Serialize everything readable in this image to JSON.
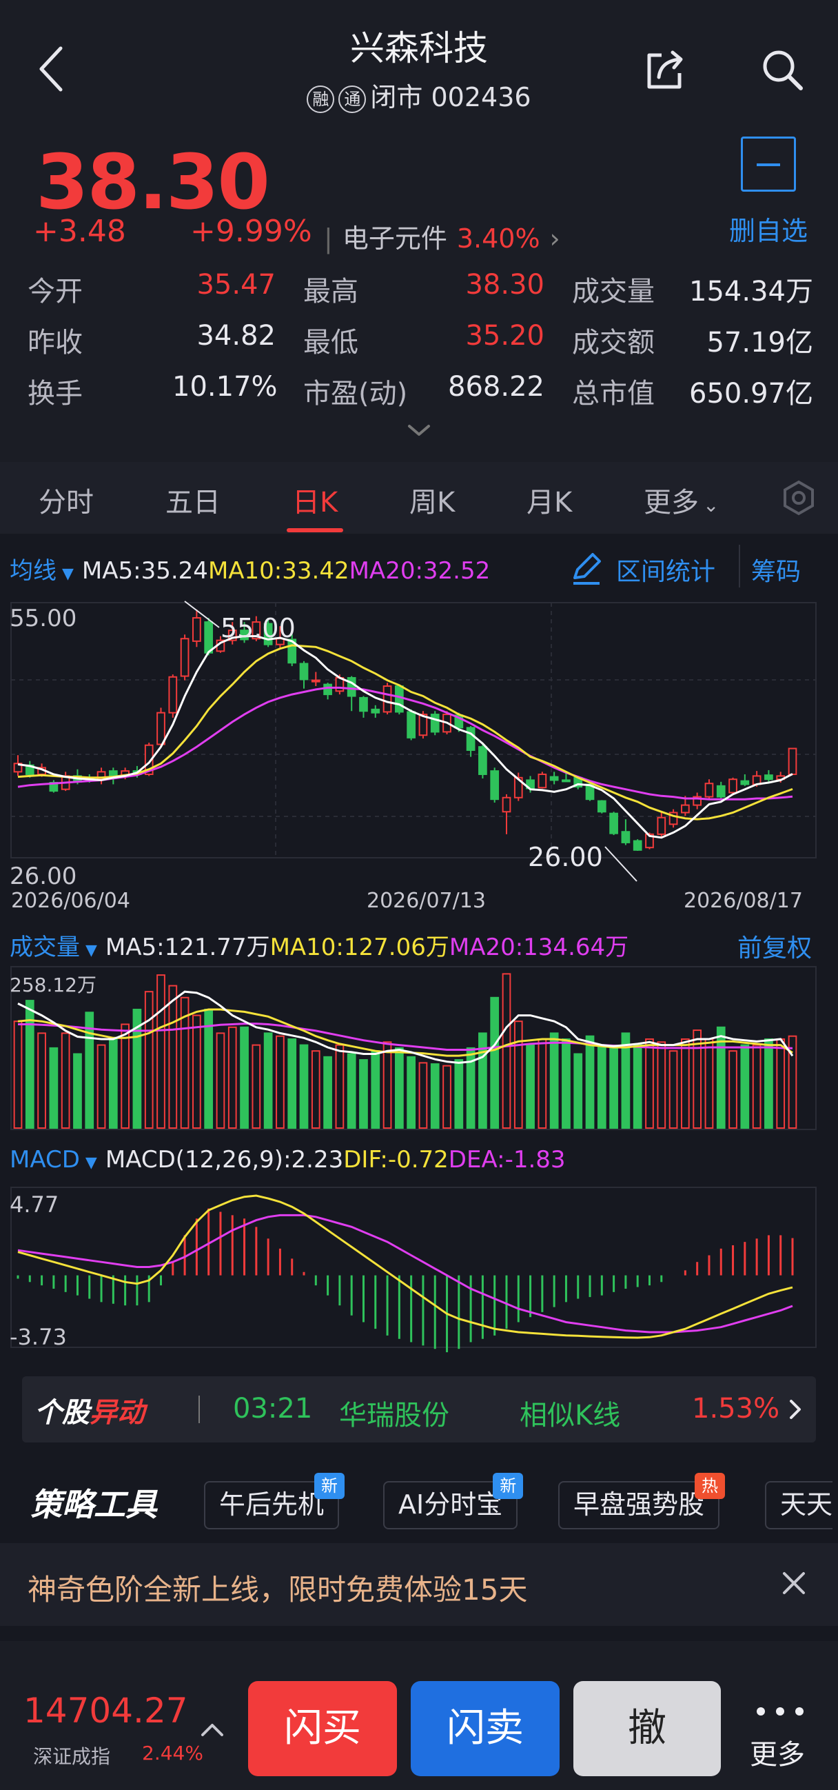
{
  "header": {
    "title": "兴森科技",
    "tag1": "融",
    "tag2": "通",
    "status_code": "闭市 002436"
  },
  "quote": {
    "price": "38.30",
    "change": "+3.48",
    "change_pct": "+9.99%",
    "sector_name": "电子元件",
    "sector_pct": "3.40%",
    "fav_label": "删自选",
    "stats": {
      "open_label": "今开",
      "open": "35.47",
      "high_label": "最高",
      "high": "38.30",
      "vol_label": "成交量",
      "vol": "154.34万",
      "prev_label": "昨收",
      "prev": "34.82",
      "low_label": "最低",
      "low": "35.20",
      "amt_label": "成交额",
      "amt": "57.19亿",
      "turn_label": "换手",
      "turn": "10.17%",
      "pe_label": "市盈(动)",
      "pe": "868.22",
      "mcap_label": "总市值",
      "mcap": "650.97亿"
    }
  },
  "tabs": [
    "分时",
    "五日",
    "日K",
    "周K",
    "月K",
    "更多"
  ],
  "ma_legend": {
    "label": "均线",
    "ma5": "MA5:35.24",
    "ma10": "MA10:33.42",
    "ma20": "MA20:32.52",
    "range_stats": "区间统计",
    "chips": "筹码"
  },
  "vol_legend": {
    "label": "成交量",
    "ma5": "MA5:121.77万",
    "ma10": "MA10:127.06万",
    "ma20": "MA20:134.64万",
    "adjust": "前复权"
  },
  "macd_legend": {
    "label": "MACD",
    "macd": "MACD(12,26,9):2.23",
    "dif": "DIF:-0.72",
    "dea": "DEA:-1.83"
  },
  "chart_data": [
    {
      "type": "candlestick",
      "title": "",
      "y_range": [
        26.0,
        55.0
      ],
      "max_label": "55.00",
      "min_label": "26.00",
      "high_mark": "55.00",
      "low_mark": "26.00",
      "x_labels": [
        "2026/06/04",
        "2026/07/13",
        "2026/08/17"
      ],
      "candles": [
        {
          "o": 35.5,
          "c": 36.5,
          "h": 37.5,
          "l": 35.0
        },
        {
          "o": 36.3,
          "c": 35.2,
          "h": 36.8,
          "l": 34.8
        },
        {
          "o": 35.2,
          "c": 36.0,
          "h": 36.5,
          "l": 34.9
        },
        {
          "o": 34.2,
          "c": 33.2,
          "h": 34.5,
          "l": 33.0
        },
        {
          "o": 33.4,
          "c": 35.0,
          "h": 35.5,
          "l": 33.2
        },
        {
          "o": 35.0,
          "c": 34.3,
          "h": 35.8,
          "l": 34.0
        },
        {
          "o": 34.8,
          "c": 34.6,
          "h": 35.2,
          "l": 34.2
        },
        {
          "o": 34.6,
          "c": 35.5,
          "h": 36.0,
          "l": 34.0
        },
        {
          "o": 35.6,
          "c": 34.9,
          "h": 36.0,
          "l": 34.0
        },
        {
          "o": 35.0,
          "c": 35.6,
          "h": 36.0,
          "l": 34.6
        },
        {
          "o": 35.6,
          "c": 35.2,
          "h": 36.2,
          "l": 34.8
        },
        {
          "o": 35.2,
          "c": 38.7,
          "h": 39.0,
          "l": 35.0
        },
        {
          "o": 38.8,
          "c": 42.6,
          "h": 43.2,
          "l": 38.5
        },
        {
          "o": 42.6,
          "c": 46.9,
          "h": 47.2,
          "l": 42.0
        },
        {
          "o": 47.0,
          "c": 51.5,
          "h": 52.0,
          "l": 46.5
        },
        {
          "o": 51.2,
          "c": 54.0,
          "h": 55.0,
          "l": 50.5
        },
        {
          "o": 53.5,
          "c": 49.8,
          "h": 54.0,
          "l": 49.5
        },
        {
          "o": 50.0,
          "c": 51.3,
          "h": 51.8,
          "l": 49.8
        },
        {
          "o": 51.3,
          "c": 52.5,
          "h": 53.5,
          "l": 50.8
        },
        {
          "o": 52.5,
          "c": 51.4,
          "h": 53.5,
          "l": 51.0
        },
        {
          "o": 51.5,
          "c": 53.5,
          "h": 54.2,
          "l": 51.2
        },
        {
          "o": 53.3,
          "c": 50.8,
          "h": 54.0,
          "l": 50.5
        },
        {
          "o": 50.8,
          "c": 51.5,
          "h": 53.0,
          "l": 50.2
        },
        {
          "o": 51.4,
          "c": 48.6,
          "h": 52.0,
          "l": 48.2
        },
        {
          "o": 48.5,
          "c": 46.6,
          "h": 48.8,
          "l": 45.5
        },
        {
          "o": 46.5,
          "c": 46.5,
          "h": 47.5,
          "l": 45.8
        },
        {
          "o": 46.0,
          "c": 44.8,
          "h": 46.2,
          "l": 44.2
        },
        {
          "o": 45.2,
          "c": 46.8,
          "h": 47.2,
          "l": 44.8
        },
        {
          "o": 46.8,
          "c": 44.6,
          "h": 47.0,
          "l": 42.8
        },
        {
          "o": 44.4,
          "c": 42.8,
          "h": 44.6,
          "l": 42.0
        },
        {
          "o": 43.0,
          "c": 42.6,
          "h": 43.5,
          "l": 42.0
        },
        {
          "o": 42.7,
          "c": 45.8,
          "h": 46.2,
          "l": 42.4
        },
        {
          "o": 45.8,
          "c": 42.7,
          "h": 46.0,
          "l": 42.4
        },
        {
          "o": 42.7,
          "c": 39.6,
          "h": 43.0,
          "l": 39.3
        },
        {
          "o": 39.9,
          "c": 42.4,
          "h": 42.8,
          "l": 39.5
        },
        {
          "o": 42.4,
          "c": 40.3,
          "h": 42.8,
          "l": 39.9
        },
        {
          "o": 40.3,
          "c": 42.4,
          "h": 42.8,
          "l": 40.0
        },
        {
          "o": 42.3,
          "c": 40.8,
          "h": 42.6,
          "l": 40.3
        },
        {
          "o": 40.8,
          "c": 38.1,
          "h": 41.0,
          "l": 37.3
        },
        {
          "o": 38.5,
          "c": 35.2,
          "h": 38.8,
          "l": 34.7
        },
        {
          "o": 35.6,
          "c": 32.2,
          "h": 36.0,
          "l": 31.8
        },
        {
          "o": 30.7,
          "c": 32.4,
          "h": 32.8,
          "l": 28.0
        },
        {
          "o": 32.4,
          "c": 34.8,
          "h": 35.4,
          "l": 32.0
        },
        {
          "o": 34.5,
          "c": 33.5,
          "h": 35.0,
          "l": 33.0
        },
        {
          "o": 33.6,
          "c": 35.2,
          "h": 35.5,
          "l": 33.5
        },
        {
          "o": 34.9,
          "c": 34.5,
          "h": 35.5,
          "l": 34.0
        },
        {
          "o": 34.5,
          "c": 34.4,
          "h": 35.5,
          "l": 34.3
        },
        {
          "o": 34.8,
          "c": 33.7,
          "h": 35.0,
          "l": 33.4
        },
        {
          "o": 34.0,
          "c": 32.2,
          "h": 34.1,
          "l": 32.0
        },
        {
          "o": 32.0,
          "c": 30.7,
          "h": 32.1,
          "l": 30.5
        },
        {
          "o": 30.5,
          "c": 28.1,
          "h": 30.7,
          "l": 27.9
        },
        {
          "o": 28.3,
          "c": 27.0,
          "h": 29.8,
          "l": 26.7
        },
        {
          "o": 27.2,
          "c": 26.1,
          "h": 27.4,
          "l": 26.0
        },
        {
          "o": 26.4,
          "c": 28.0,
          "h": 28.2,
          "l": 26.2
        },
        {
          "o": 28.0,
          "c": 30.0,
          "h": 30.8,
          "l": 27.6
        },
        {
          "o": 29.2,
          "c": 30.6,
          "h": 31.0,
          "l": 28.8
        },
        {
          "o": 30.6,
          "c": 31.5,
          "h": 32.6,
          "l": 30.2
        },
        {
          "o": 31.5,
          "c": 32.5,
          "h": 33.0,
          "l": 31.0
        },
        {
          "o": 32.5,
          "c": 34.1,
          "h": 34.6,
          "l": 32.3
        },
        {
          "o": 33.8,
          "c": 32.5,
          "h": 34.3,
          "l": 32.2
        },
        {
          "o": 33.0,
          "c": 34.6,
          "h": 34.8,
          "l": 32.7
        },
        {
          "o": 34.4,
          "c": 34.0,
          "h": 35.2,
          "l": 33.8
        },
        {
          "o": 34.0,
          "c": 35.0,
          "h": 35.6,
          "l": 33.7
        },
        {
          "o": 35.1,
          "c": 34.6,
          "h": 35.7,
          "l": 34.3
        },
        {
          "o": 34.6,
          "c": 35.0,
          "h": 35.5,
          "l": 34.2
        },
        {
          "o": 35.2,
          "c": 38.3,
          "h": 38.3,
          "l": 35.2
        }
      ],
      "ma5": [
        36.4,
        36.2,
        35.8,
        35.2,
        34.9,
        34.7,
        34.6,
        34.5,
        34.8,
        35.0,
        35.4,
        36.6,
        38.5,
        41.2,
        44.6,
        47.5,
        49.9,
        51.0,
        51.6,
        51.8,
        51.8,
        51.4,
        51.6,
        51.2,
        50.1,
        49.2,
        47.8,
        46.8,
        46.2,
        45.2,
        44.4,
        43.9,
        43.6,
        42.8,
        42.2,
        41.8,
        41.4,
        40.6,
        40.1,
        38.9,
        37.4,
        35.8,
        34.6,
        33.4,
        33.3,
        33.1,
        33.4,
        34.0,
        33.9,
        33.3,
        32.3,
        30.8,
        29.3,
        27.8,
        27.6,
        28.2,
        29.0,
        30.3,
        31.6,
        31.9,
        32.8,
        33.4,
        34.0,
        34.2,
        34.5,
        35.24
      ],
      "ma10": [
        34.9,
        35.0,
        35.1,
        35.0,
        34.9,
        34.9,
        34.8,
        34.8,
        34.9,
        35.1,
        35.3,
        35.8,
        36.5,
        37.7,
        39.3,
        41.0,
        43.0,
        44.6,
        46.0,
        47.5,
        48.8,
        49.7,
        50.3,
        50.7,
        50.6,
        50.5,
        50.0,
        49.4,
        48.8,
        48.0,
        47.3,
        46.5,
        45.9,
        45.1,
        44.6,
        43.8,
        43.2,
        42.4,
        41.9,
        41.2,
        40.3,
        39.3,
        38.4,
        37.3,
        36.8,
        36.2,
        35.5,
        34.8,
        34.2,
        33.6,
        33.0,
        32.4,
        31.9,
        31.2,
        30.7,
        30.2,
        29.9,
        29.8,
        29.9,
        30.2,
        30.6,
        31.2,
        31.8,
        32.4,
        32.9,
        33.42
      ],
      "ma20": [
        33.7,
        33.9,
        34.0,
        34.1,
        34.2,
        34.3,
        34.4,
        34.5,
        34.7,
        34.9,
        35.1,
        35.6,
        36.1,
        36.8,
        37.6,
        38.5,
        39.5,
        40.5,
        41.5,
        42.4,
        43.2,
        43.9,
        44.4,
        44.8,
        45.1,
        45.4,
        45.6,
        45.6,
        45.5,
        45.4,
        45.1,
        44.8,
        44.5,
        44.1,
        43.7,
        43.2,
        42.6,
        42.0,
        41.3,
        40.5,
        39.8,
        39.0,
        38.2,
        37.4,
        36.7,
        36.0,
        35.4,
        34.9,
        34.4,
        34.0,
        33.7,
        33.4,
        33.1,
        32.8,
        32.6,
        32.5,
        32.3,
        32.3,
        32.2,
        32.2,
        32.2,
        32.2,
        32.3,
        32.3,
        32.4,
        32.52
      ]
    },
    {
      "type": "bar",
      "title": "成交量",
      "max_label": "258.12万",
      "y_range": [
        0,
        258.12
      ],
      "values": [
        180,
        215,
        160,
        135,
        160,
        125,
        195,
        140,
        150,
        175,
        200,
        230,
        258,
        240,
        220,
        190,
        200,
        160,
        170,
        170,
        140,
        160,
        155,
        150,
        140,
        130,
        120,
        140,
        125,
        115,
        130,
        145,
        135,
        120,
        110,
        108,
        105,
        115,
        135,
        160,
        220,
        260,
        180,
        140,
        150,
        160,
        150,
        125,
        155,
        140,
        135,
        160,
        140,
        150,
        145,
        130,
        150,
        165,
        150,
        170,
        130,
        140,
        140,
        150,
        150,
        155
      ],
      "ma5": [
        210,
        200,
        190,
        178,
        164,
        154,
        152,
        150,
        150,
        158,
        170,
        182,
        198,
        215,
        230,
        228,
        220,
        206,
        190,
        180,
        170,
        166,
        160,
        156,
        152,
        145,
        136,
        130,
        128,
        125,
        125,
        130,
        132,
        128,
        122,
        116,
        112,
        110,
        112,
        120,
        140,
        170,
        190,
        190,
        185,
        180,
        170,
        150,
        145,
        140,
        138,
        140,
        142,
        145,
        140,
        140,
        145,
        150,
        150,
        155,
        150,
        148,
        146,
        148,
        150,
        121.77
      ],
      "ma10": [
        180,
        182,
        180,
        176,
        172,
        166,
        160,
        156,
        152,
        152,
        154,
        160,
        170,
        178,
        188,
        196,
        200,
        200,
        198,
        196,
        192,
        188,
        180,
        172,
        164,
        155,
        148,
        142,
        138,
        134,
        130,
        128,
        128,
        127,
        126,
        124,
        122,
        122,
        124,
        128,
        132,
        140,
        146,
        148,
        150,
        150,
        148,
        144,
        140,
        138,
        136,
        136,
        138,
        140,
        140,
        140,
        140,
        142,
        144,
        146,
        146,
        144,
        142,
        140,
        140,
        127.06
      ],
      "ma20": [
        175,
        175,
        174,
        173,
        172,
        170,
        168,
        166,
        165,
        164,
        164,
        164,
        165,
        166,
        168,
        170,
        172,
        174,
        175,
        176,
        176,
        175,
        173,
        170,
        167,
        164,
        160,
        156,
        152,
        148,
        145,
        142,
        140,
        138,
        136,
        134,
        132,
        132,
        132,
        134,
        136,
        138,
        140,
        142,
        143,
        144,
        144,
        143,
        142,
        140,
        139,
        138,
        137,
        136,
        135,
        135,
        135,
        135,
        136,
        136,
        136,
        136,
        136,
        136,
        135,
        134.64
      ]
    },
    {
      "type": "macd",
      "title": "MACD",
      "max_label": "4.77",
      "min_label": "-3.73",
      "y_range": [
        -3.73,
        4.77
      ],
      "dif": [
        1.4,
        1.2,
        1.0,
        0.8,
        0.6,
        0.4,
        0.2,
        0.0,
        -0.2,
        -0.4,
        -0.5,
        -0.3,
        0.3,
        1.2,
        2.3,
        3.2,
        3.9,
        4.2,
        4.5,
        4.7,
        4.77,
        4.6,
        4.4,
        4.1,
        3.7,
        3.2,
        2.7,
        2.2,
        1.7,
        1.2,
        0.7,
        0.2,
        -0.3,
        -0.8,
        -1.3,
        -1.8,
        -2.3,
        -2.6,
        -2.8,
        -3.0,
        -3.2,
        -3.3,
        -3.4,
        -3.45,
        -3.5,
        -3.55,
        -3.6,
        -3.62,
        -3.65,
        -3.68,
        -3.7,
        -3.72,
        -3.73,
        -3.7,
        -3.6,
        -3.4,
        -3.2,
        -2.9,
        -2.6,
        -2.3,
        -2.0,
        -1.7,
        -1.4,
        -1.1,
        -0.9,
        -0.72
      ],
      "dea": [
        1.5,
        1.4,
        1.3,
        1.2,
        1.1,
        1.0,
        0.9,
        0.8,
        0.7,
        0.6,
        0.5,
        0.5,
        0.6,
        0.8,
        1.1,
        1.5,
        1.9,
        2.3,
        2.7,
        3.0,
        3.3,
        3.5,
        3.6,
        3.6,
        3.6,
        3.5,
        3.3,
        3.1,
        2.9,
        2.6,
        2.3,
        2.0,
        1.6,
        1.2,
        0.8,
        0.4,
        0.0,
        -0.4,
        -0.8,
        -1.1,
        -1.4,
        -1.7,
        -2.0,
        -2.2,
        -2.4,
        -2.6,
        -2.8,
        -2.9,
        -3.0,
        -3.1,
        -3.2,
        -3.3,
        -3.35,
        -3.4,
        -3.4,
        -3.4,
        -3.35,
        -3.3,
        -3.2,
        -3.1,
        -2.9,
        -2.7,
        -2.5,
        -2.3,
        -2.1,
        -1.83
      ],
      "hist": [
        -0.2,
        -0.4,
        -0.6,
        -0.8,
        -1.0,
        -1.2,
        -1.4,
        -1.6,
        -1.7,
        -1.8,
        -1.8,
        -1.6,
        -0.6,
        0.8,
        2.4,
        3.4,
        4.0,
        3.8,
        3.6,
        3.4,
        2.9,
        2.2,
        1.6,
        1.0,
        0.2,
        -0.6,
        -1.2,
        -1.8,
        -2.4,
        -2.8,
        -3.2,
        -3.6,
        -3.8,
        -4.0,
        -4.2,
        -4.4,
        -4.6,
        -4.4,
        -4.0,
        -3.8,
        -3.6,
        -3.2,
        -2.8,
        -2.5,
        -2.2,
        -1.9,
        -1.6,
        -1.4,
        -1.3,
        -1.2,
        -1.0,
        -0.8,
        -0.7,
        -0.6,
        -0.4,
        0.0,
        0.3,
        0.8,
        1.2,
        1.6,
        1.8,
        2.0,
        2.2,
        2.4,
        2.4,
        2.23
      ]
    }
  ],
  "banner": {
    "logo_a": "个股",
    "logo_b": "异动",
    "time": "03:21",
    "stock": "华瑞股份",
    "kline": "相似K线",
    "pct": "1.53%"
  },
  "strategy": {
    "logo": "策略工具",
    "chips": [
      {
        "label": "午后先机",
        "badge": "新"
      },
      {
        "label": "AI分时宝",
        "badge": "新"
      },
      {
        "label": "早盘强势股",
        "badge": "热"
      },
      {
        "label": "天天",
        "badge": ""
      }
    ]
  },
  "promo": {
    "text": "神奇色阶全新上线，限时免费体验15天"
  },
  "bottom": {
    "index_value": "14704.27",
    "index_name": "深证成指",
    "index_pct": "2.44%",
    "buy": "闪买",
    "sell": "闪卖",
    "cancel": "撤",
    "more": "更多"
  },
  "colors": {
    "up": "#f23b3b",
    "down": "#2fc25b",
    "accent": "#2f8ff0",
    "ma5": "#ffffff",
    "ma10": "#f5e23a",
    "ma20": "#e03ef0"
  }
}
